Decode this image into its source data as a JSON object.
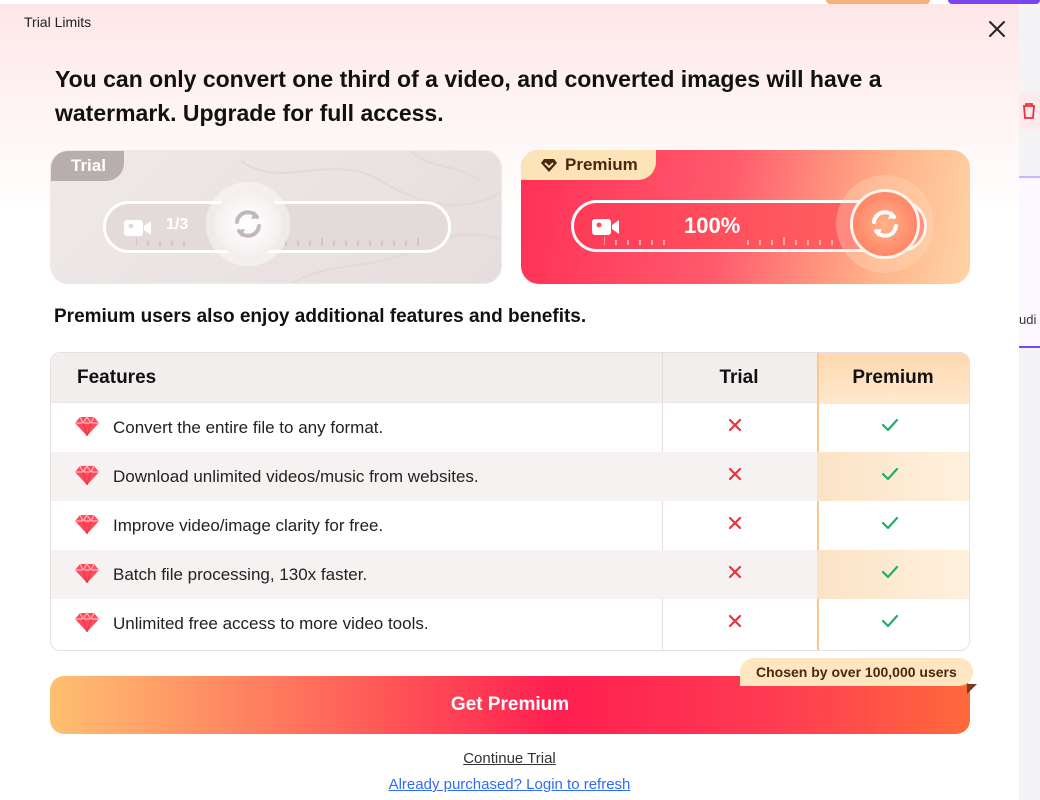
{
  "dialog": {
    "title": "Trial Limits",
    "headline": "You can only convert one third of a video, and converted images will have a watermark. Upgrade for full access."
  },
  "trial_card": {
    "tag": "Trial",
    "progress_label": "1/3",
    "progress_fraction": 0.333
  },
  "premium_card": {
    "tag": "Premium",
    "progress_label": "100%",
    "progress_fraction": 1.0
  },
  "subheading": "Premium users also enjoy additional features and benefits.",
  "table": {
    "headers": {
      "features": "Features",
      "trial": "Trial",
      "premium": "Premium"
    },
    "rows": [
      {
        "feature": "Convert the entire file to any format.",
        "trial": false,
        "premium": true
      },
      {
        "feature": "Download unlimited videos/music from websites.",
        "trial": false,
        "premium": true
      },
      {
        "feature": "Improve video/image clarity for free.",
        "trial": false,
        "premium": true
      },
      {
        "feature": "Batch file processing, 130x faster.",
        "trial": false,
        "premium": true
      },
      {
        "feature": "Unlimited free access to more video tools.",
        "trial": false,
        "premium": true
      }
    ]
  },
  "cta": {
    "button_label": "Get Premium",
    "badge": "Chosen by over 100,000 users"
  },
  "links": {
    "continue_trial": "Continue Trial",
    "login_refresh": "Already purchased? Login to refresh"
  },
  "background_app": {
    "partial_label": "udi"
  },
  "colors": {
    "cross": "#e8333f",
    "check": "#1fae6a",
    "premium_gold": "#fde3b8",
    "cta_red": "#ff1f50",
    "link_blue": "#2f6bff"
  },
  "icons": {
    "close": "close-icon",
    "gem": "gem-icon",
    "camera": "video-camera-icon",
    "convert": "refresh-icon",
    "crown": "diamond-crown-icon"
  }
}
